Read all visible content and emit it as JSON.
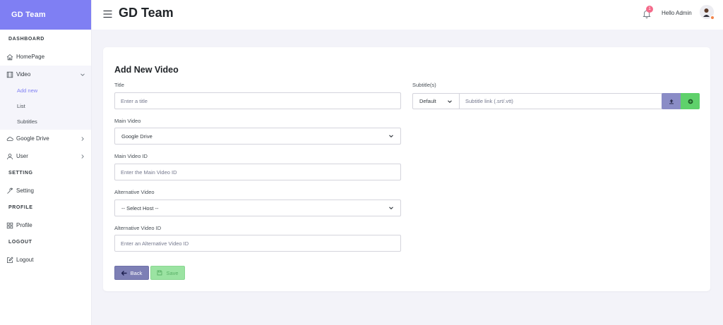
{
  "brand": "GD Team",
  "sidebar": {
    "sections": {
      "dashboard": "DASHBOARD",
      "setting": "SETTING",
      "profile": "PROFILE",
      "logout": "LOGOUT"
    },
    "items": {
      "homepage": "HomePage",
      "video": "Video",
      "video_add_new": "Add new",
      "video_list": "List",
      "video_subtitles": "Subtitles",
      "google_drive": "Google Drive",
      "user": "User",
      "setting": "Setting",
      "profile": "Profile",
      "logout": "Logout"
    }
  },
  "header": {
    "title": "GD Team",
    "notification_count": "1",
    "greeting": "Hello Admin"
  },
  "form": {
    "heading": "Add New Video",
    "title_label": "Title",
    "title_placeholder": "Enter a title",
    "main_video_label": "Main Video",
    "main_video_value": "Google Drive",
    "main_video_id_label": "Main Video ID",
    "main_video_id_placeholder": "Enter the Main Video ID",
    "alt_video_label": "Alternative Video",
    "alt_video_value": "-- Select Host --",
    "alt_video_id_label": "Alternative Video ID",
    "alt_video_id_placeholder": "Enter an Alternative Video ID",
    "subtitles_label": "Subtitle(s)",
    "subtitle_lang_value": "Default",
    "subtitle_link_placeholder": "Subtitle link (.srt/.vtt)",
    "back_label": "Back",
    "save_label": "Save"
  },
  "colors": {
    "brand": "#7f7ff3",
    "back_button": "#7d7fb5",
    "save_button": "#9be3a2",
    "upload_button": "#8a8cc6",
    "add_button": "#5fd16b",
    "badge": "#f46a8a"
  },
  "icons": {
    "homepage": "home-icon",
    "video": "film-icon",
    "google_drive": "cloud-icon",
    "user": "user-icon",
    "setting": "wrench-icon",
    "profile": "grid-icon",
    "logout": "edit-icon"
  }
}
